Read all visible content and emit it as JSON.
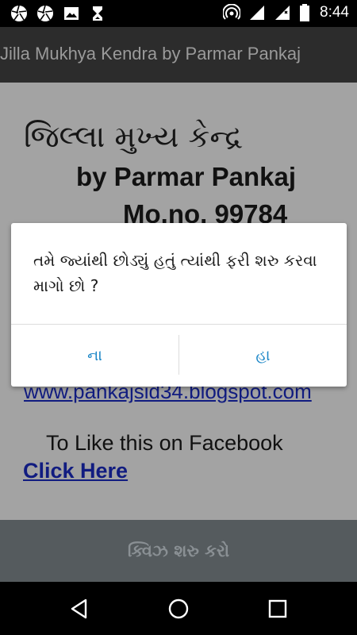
{
  "status_bar": {
    "left_icons": [
      "aperture-icon",
      "aperture-icon",
      "image-icon",
      "hourglass-icon"
    ],
    "right_icons": [
      "hotspot-icon",
      "signal-icon",
      "signal-icon",
      "battery-icon"
    ],
    "time": "8:44"
  },
  "action_bar": {
    "title": "Jilla Mukhya Kendra by Parmar Pankaj"
  },
  "content": {
    "gujarati_title": "જિલ્લા મુખ્ય કેન્દ્ર",
    "by_line": "by Parmar Pankaj",
    "mobile_line": "Mo.no. 99784",
    "blog_link": "www.pankajsid34.blogspot.com",
    "like_text": "To Like this on Facebook",
    "click_here": "Click Here",
    "start_quiz_button": "ક્વિઝ શરુ કરો"
  },
  "dialog": {
    "message": "તમે જ્યાંથી છોડ્યું હતું ત્યાંથી ફરી શરુ કરવા માગો છો ?",
    "negative_button": "ના",
    "positive_button": "હા",
    "button_color": "#1e88c8"
  },
  "nav_bar": {
    "icons": [
      "back-icon",
      "home-icon",
      "recents-icon"
    ]
  }
}
